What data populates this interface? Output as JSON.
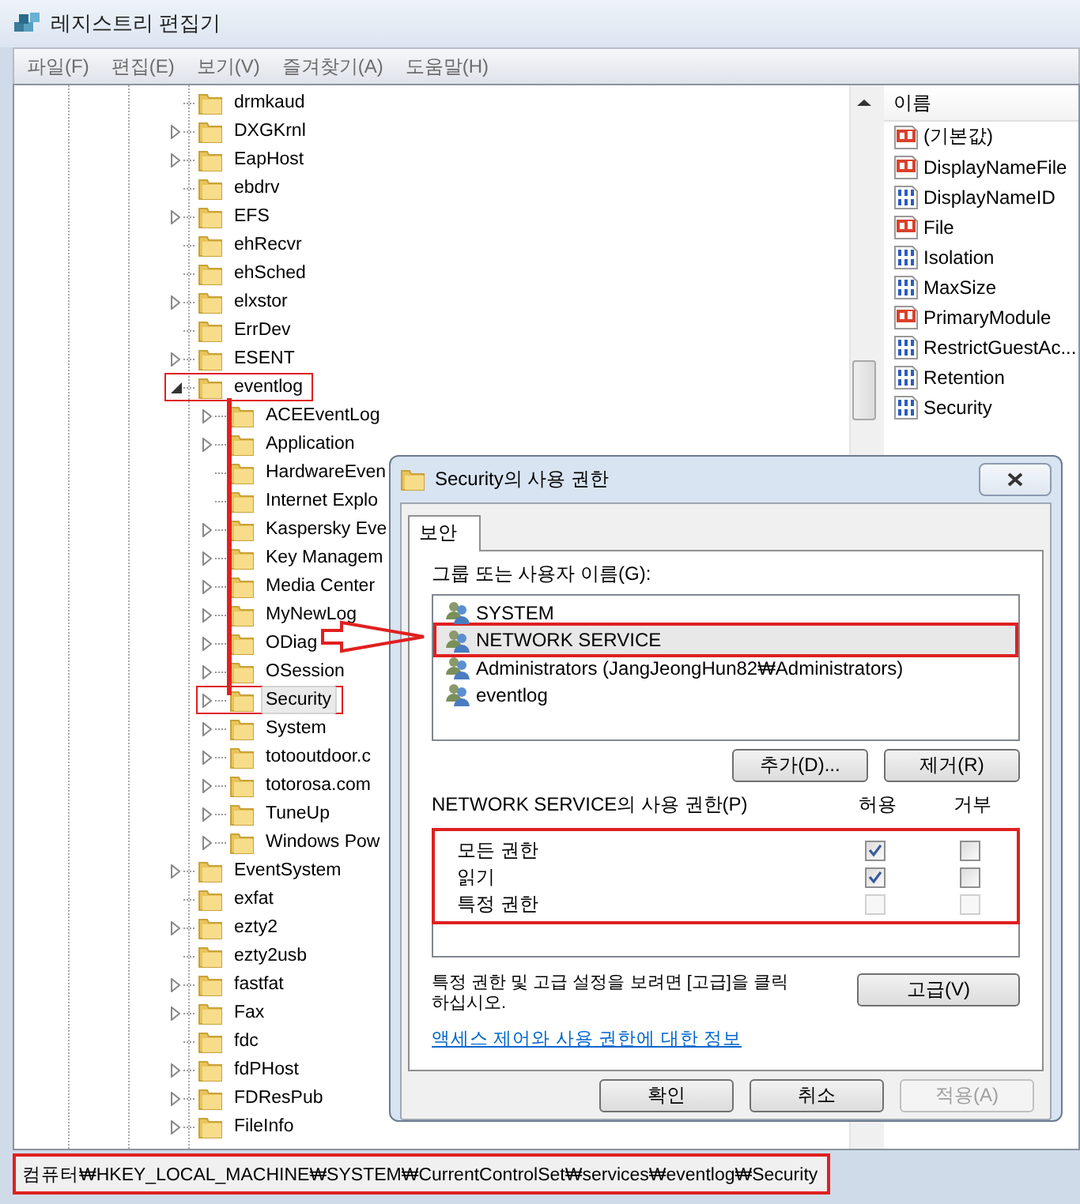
{
  "window": {
    "title": "레지스트리 편집기"
  },
  "menu": [
    "파일(F)",
    "편집(E)",
    "보기(V)",
    "즐겨찾기(A)",
    "도움말(H)"
  ],
  "tree": [
    {
      "name": "drmkaud",
      "kind": "leaf",
      "selected": false,
      "highlighted": false
    },
    {
      "name": "DXGKrnl",
      "kind": "collapsed",
      "selected": false,
      "highlighted": false
    },
    {
      "name": "EapHost",
      "kind": "collapsed",
      "selected": false,
      "highlighted": false
    },
    {
      "name": "ebdrv",
      "kind": "leaf",
      "selected": false,
      "highlighted": false
    },
    {
      "name": "EFS",
      "kind": "collapsed",
      "selected": false,
      "highlighted": false
    },
    {
      "name": "ehRecvr",
      "kind": "leaf",
      "selected": false,
      "highlighted": false
    },
    {
      "name": "ehSched",
      "kind": "leaf",
      "selected": false,
      "highlighted": false
    },
    {
      "name": "elxstor",
      "kind": "collapsed",
      "selected": false,
      "highlighted": false
    },
    {
      "name": "ErrDev",
      "kind": "leaf",
      "selected": false,
      "highlighted": false
    },
    {
      "name": "ESENT",
      "kind": "collapsed",
      "selected": false,
      "highlighted": false
    },
    {
      "name": "eventlog",
      "kind": "expanded",
      "selected": false,
      "highlighted": true,
      "children": [
        {
          "name": "ACEEventLog",
          "kind": "collapsed",
          "selected": false,
          "highlighted": false
        },
        {
          "name": "Application",
          "kind": "collapsed",
          "selected": false,
          "highlighted": false
        },
        {
          "name": "HardwareEven",
          "kind": "leaf",
          "selected": false,
          "highlighted": false
        },
        {
          "name": "Internet Explo",
          "kind": "leaf",
          "selected": false,
          "highlighted": false
        },
        {
          "name": "Kaspersky Eve",
          "kind": "collapsed",
          "selected": false,
          "highlighted": false
        },
        {
          "name": "Key Managem",
          "kind": "collapsed",
          "selected": false,
          "highlighted": false
        },
        {
          "name": "Media Center",
          "kind": "collapsed",
          "selected": false,
          "highlighted": false
        },
        {
          "name": "MyNewLog",
          "kind": "collapsed",
          "selected": false,
          "highlighted": false
        },
        {
          "name": "ODiag",
          "kind": "collapsed",
          "selected": false,
          "highlighted": false
        },
        {
          "name": "OSession",
          "kind": "collapsed",
          "selected": false,
          "highlighted": false
        },
        {
          "name": "Security",
          "kind": "collapsed",
          "selected": true,
          "highlighted": true
        },
        {
          "name": "System",
          "kind": "collapsed",
          "selected": false,
          "highlighted": false
        },
        {
          "name": "totooutdoor.c",
          "kind": "collapsed",
          "selected": false,
          "highlighted": false
        },
        {
          "name": "totorosa.com",
          "kind": "collapsed",
          "selected": false,
          "highlighted": false
        },
        {
          "name": "TuneUp",
          "kind": "collapsed",
          "selected": false,
          "highlighted": false
        },
        {
          "name": "Windows Pow",
          "kind": "collapsed",
          "selected": false,
          "highlighted": false
        }
      ]
    },
    {
      "name": "EventSystem",
      "kind": "collapsed",
      "selected": false,
      "highlighted": false
    },
    {
      "name": "exfat",
      "kind": "leaf",
      "selected": false,
      "highlighted": false
    },
    {
      "name": "ezty2",
      "kind": "collapsed",
      "selected": false,
      "highlighted": false
    },
    {
      "name": "ezty2usb",
      "kind": "leaf",
      "selected": false,
      "highlighted": false
    },
    {
      "name": "fastfat",
      "kind": "collapsed",
      "selected": false,
      "highlighted": false
    },
    {
      "name": "Fax",
      "kind": "collapsed",
      "selected": false,
      "highlighted": false
    },
    {
      "name": "fdc",
      "kind": "leaf",
      "selected": false,
      "highlighted": false
    },
    {
      "name": "fdPHost",
      "kind": "collapsed",
      "selected": false,
      "highlighted": false
    },
    {
      "name": "FDResPub",
      "kind": "collapsed",
      "selected": false,
      "highlighted": false
    },
    {
      "name": "FileInfo",
      "kind": "collapsed",
      "selected": false,
      "highlighted": false
    }
  ],
  "values": {
    "column": "이름",
    "items": [
      {
        "name": "(기본값)",
        "kind": "string"
      },
      {
        "name": "DisplayNameFile",
        "kind": "string"
      },
      {
        "name": "DisplayNameID",
        "kind": "binary"
      },
      {
        "name": "File",
        "kind": "string"
      },
      {
        "name": "Isolation",
        "kind": "binary"
      },
      {
        "name": "MaxSize",
        "kind": "binary"
      },
      {
        "name": "PrimaryModule",
        "kind": "string"
      },
      {
        "name": "RestrictGuestAc...",
        "kind": "binary"
      },
      {
        "name": "Retention",
        "kind": "binary"
      },
      {
        "name": "Security",
        "kind": "binary"
      }
    ]
  },
  "dialog": {
    "title": "Security의 사용 권한",
    "tabs": [
      {
        "label": "보안",
        "selected": true
      }
    ],
    "users_label": "그룹 또는 사용자 이름(G):",
    "users": [
      {
        "name": "SYSTEM",
        "selected": false,
        "highlighted": false
      },
      {
        "name": "NETWORK SERVICE",
        "selected": true,
        "highlighted": true
      },
      {
        "name": "Administrators (JangJeongHun82₩Administrators)",
        "selected": false,
        "highlighted": false
      },
      {
        "name": "eventlog",
        "selected": false,
        "highlighted": false
      }
    ],
    "user_buttons": [
      {
        "label": "추가(D)...",
        "disabled": false
      },
      {
        "label": "제거(R)",
        "disabled": false
      }
    ],
    "permissions_label": "NETWORK SERVICE의 사용 권한(P)",
    "permission_columns": [
      "허용",
      "거부"
    ],
    "permissions_highlighted": true,
    "permissions": [
      {
        "name": "모든 권한",
        "allow": {
          "checked": true,
          "disabled": false
        },
        "deny": {
          "checked": false,
          "disabled": false
        }
      },
      {
        "name": "읽기",
        "allow": {
          "checked": true,
          "disabled": false
        },
        "deny": {
          "checked": false,
          "disabled": false
        }
      },
      {
        "name": "특정 권한",
        "allow": {
          "checked": false,
          "disabled": true
        },
        "deny": {
          "checked": false,
          "disabled": true
        }
      }
    ],
    "advanced_note": "특정 권한 및 고급 설정을 보려면 [고급]을 클릭하십시오.",
    "advanced_button": "고급(V)",
    "link": "액세스 제어와 사용 권한에 대한 정보",
    "buttons": [
      {
        "label": "확인",
        "disabled": false
      },
      {
        "label": "취소",
        "disabled": false
      },
      {
        "label": "적용(A)",
        "disabled": true
      }
    ]
  },
  "status_bar": {
    "path": "컴퓨터₩HKEY_LOCAL_MACHINE₩SYSTEM₩CurrentControlSet₩services₩eventlog₩Security",
    "highlighted": true
  }
}
